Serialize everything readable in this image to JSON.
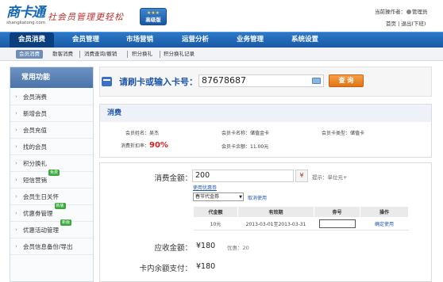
{
  "header": {
    "brand": "商卡通",
    "domain": "shangkatong.com",
    "slogan": "社会员管理更轻松",
    "badge": "高级版",
    "badge_stars": "★★★",
    "operator_label": "当前操作者：",
    "operator_name": "管理员",
    "home_link": "首页",
    "separator": "|",
    "logout_link": "退出(下班)"
  },
  "nav": {
    "items": [
      "会员消费",
      "会员管理",
      "市场营销",
      "运营分析",
      "业务管理",
      "系统设置"
    ],
    "active": "会员消费"
  },
  "subnav": {
    "items": [
      "会员消费",
      "散客消费",
      "消费查询/撤销",
      "积分换礼",
      "积分换礼记录"
    ]
  },
  "sidebar": {
    "title": "常用功能",
    "items": [
      {
        "label": "会员消费",
        "tag": ""
      },
      {
        "label": "新增会员",
        "tag": ""
      },
      {
        "label": "会员充值",
        "tag": ""
      },
      {
        "label": "找的会员",
        "tag": ""
      },
      {
        "label": "积分换礼",
        "tag": ""
      },
      {
        "label": "短信营销",
        "tag": "免费"
      },
      {
        "label": "会员生日关怀",
        "tag": ""
      },
      {
        "label": "优惠劵管理",
        "tag": "新版"
      },
      {
        "label": "优惠活动管理",
        "tag": "新版"
      },
      {
        "label": "会员信息备份/导出",
        "tag": ""
      }
    ],
    "tag_colors": {
      "免费": "#3aa83a",
      "新版": "#3aa83a"
    }
  },
  "card": {
    "label": "请刷卡或输入卡号：",
    "value": "87678687",
    "query_button": "查 询"
  },
  "consume": {
    "title": "消费",
    "member_name_label": "会员姓名：",
    "member_name": "吴杰",
    "card_name_label": "会员卡名称：",
    "card_name": "储值金卡",
    "card_type_label": "会员卡类型：",
    "card_type": "储值卡",
    "discount_label": "消费折扣率：",
    "discount": "90%",
    "balance_label": "会员卡余额：",
    "balance": "11.00元"
  },
  "form": {
    "amount_label": "消费金额：",
    "amount_value": "200",
    "calc_icon": "¥",
    "hint": "提示：单位元+",
    "use_coupon_link": "使用优惠劵",
    "coupon_select": "春节代金券",
    "cancel_link": "取消使用",
    "table": {
      "headers": [
        "代金额",
        "有效期",
        "劵号",
        "操作"
      ],
      "rows": [
        {
          "amount": "10元",
          "validity": "2013-03-01至2013-03-31",
          "code": "",
          "action": "确定使用"
        }
      ]
    },
    "receivable_label": "应收金额：",
    "receivable_value": "¥180",
    "discount_note": "优惠：20",
    "card_pay_label": "卡内余额支付：",
    "card_pay_value": "¥180"
  },
  "colors": {
    "nav_bg": "#1f63ae",
    "accent_blue": "#1e55a8",
    "query_orange": "#e07512",
    "discount_red": "#d42020"
  }
}
